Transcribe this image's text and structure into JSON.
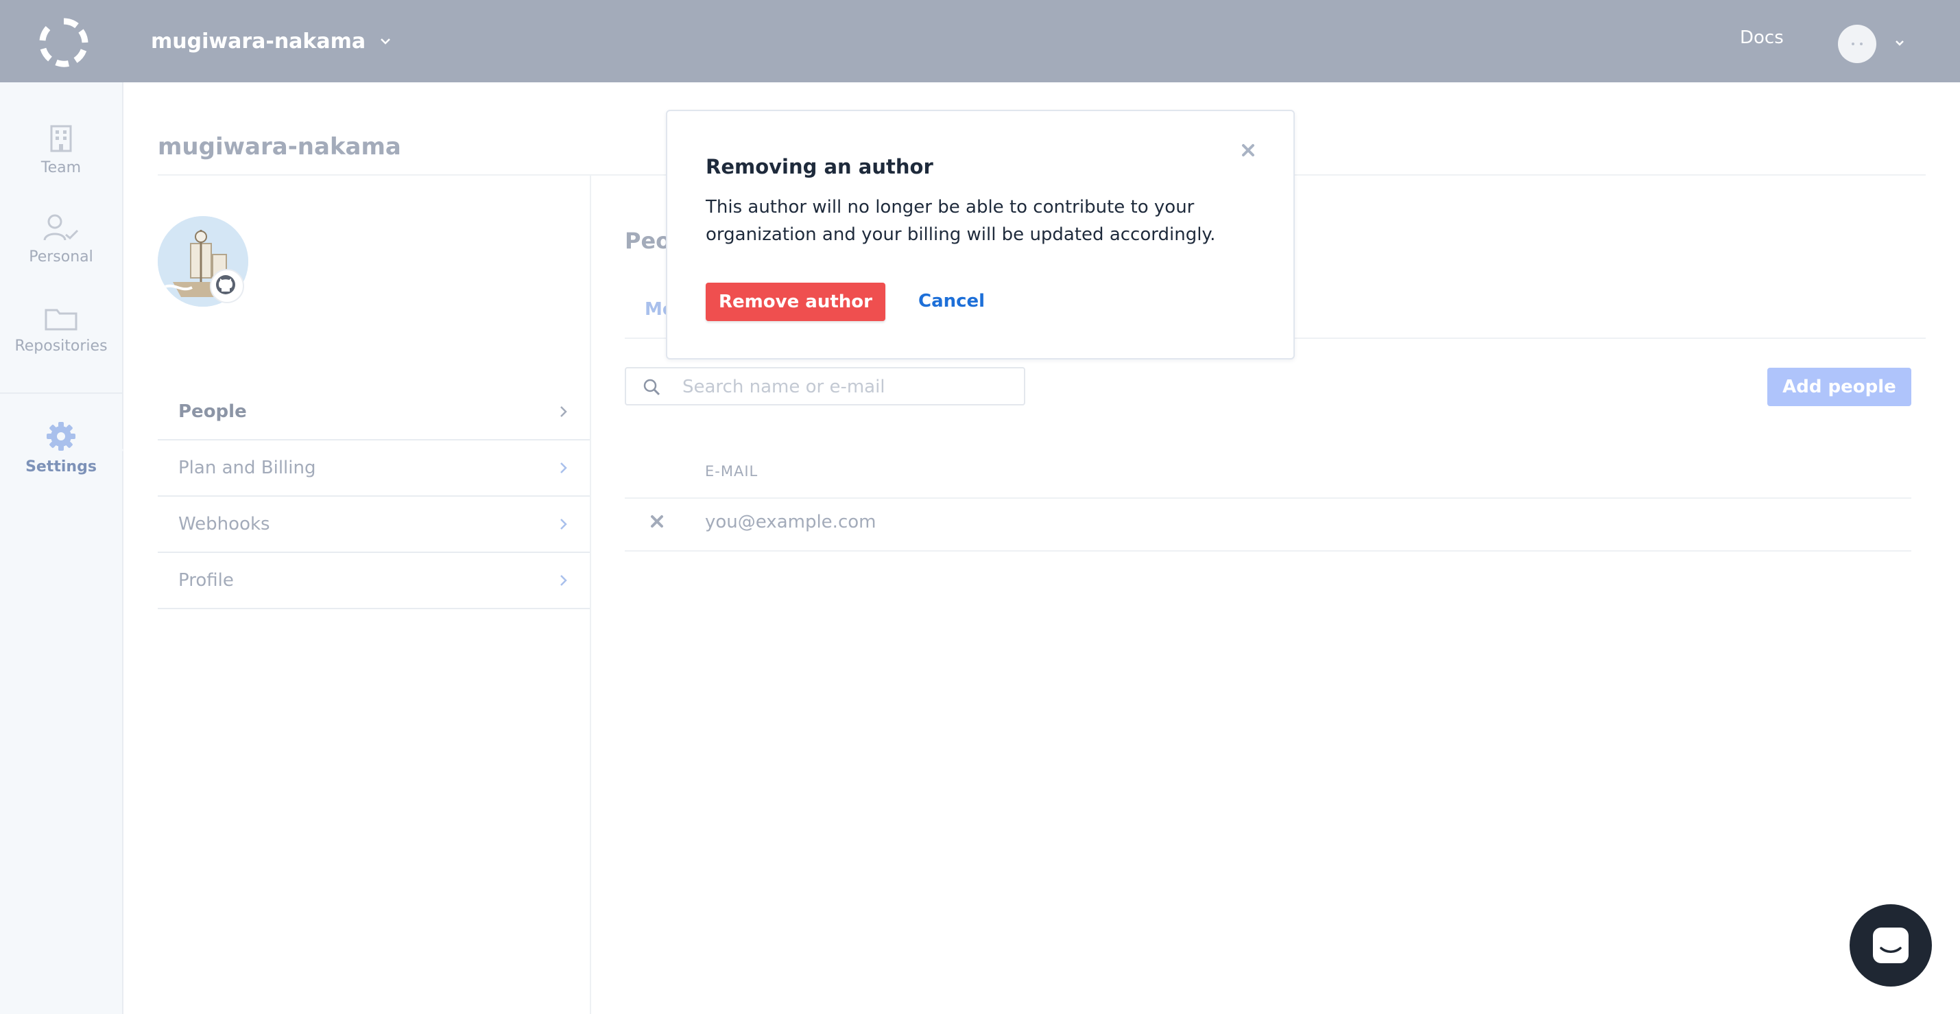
{
  "topbar": {
    "org_name": "mugiwara-nakama",
    "docs_label": "Docs"
  },
  "rail": {
    "items": [
      {
        "label": "Team",
        "icon": "building-icon"
      },
      {
        "label": "Personal",
        "icon": "user-check-icon"
      },
      {
        "label": "Repositories",
        "icon": "folder-icon"
      },
      {
        "label": "Settings",
        "icon": "gear-icon",
        "active": true
      }
    ]
  },
  "page": {
    "title": "mugiwara-nakama"
  },
  "settings_menu": {
    "items": [
      {
        "label": "People",
        "active": true
      },
      {
        "label": "Plan and Billing"
      },
      {
        "label": "Webhooks"
      },
      {
        "label": "Profile"
      }
    ]
  },
  "people": {
    "section_title": "Peo",
    "tab_label": "Mo",
    "search": {
      "placeholder": "Search name or e-mail",
      "value": ""
    },
    "add_button": "Add people",
    "table": {
      "columns": [
        "E-MAIL"
      ],
      "rows": [
        {
          "email": "you@example.com"
        }
      ]
    }
  },
  "modal": {
    "title": "Removing an author",
    "body": "This author will no longer be able to contribute to your organization and your billing will be updated accordingly.",
    "confirm_label": "Remove author",
    "cancel_label": "Cancel"
  },
  "colors": {
    "topbar": "#a3abba",
    "danger": "#ef4f4f",
    "link": "#1d6fd8",
    "primary_disabled": "#afc4fb"
  }
}
